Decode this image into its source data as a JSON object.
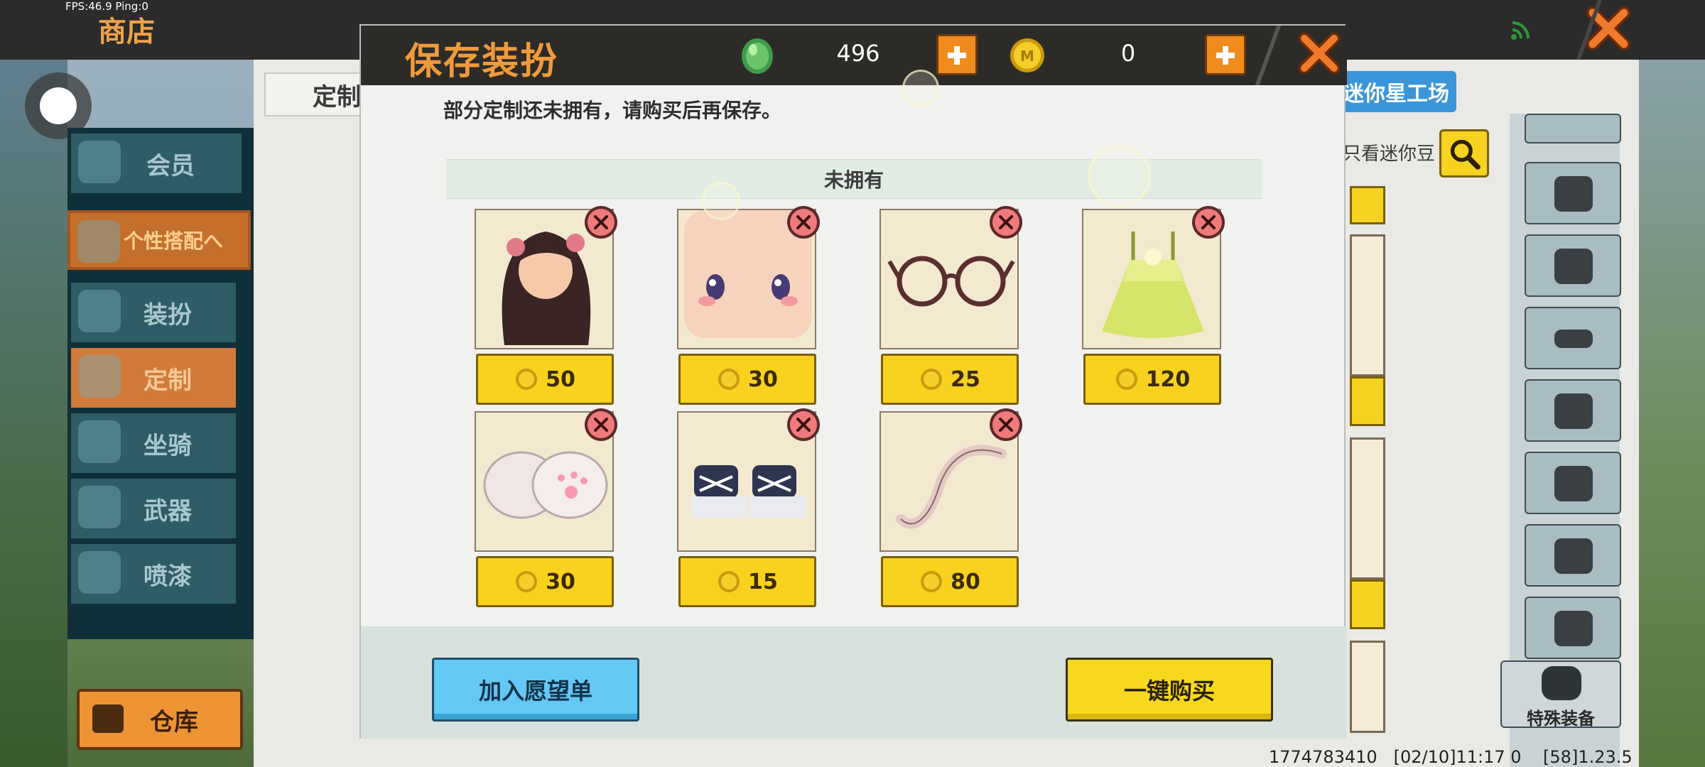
{
  "debug": {
    "fps_text": "FPS:46.9  Ping:0"
  },
  "topbar": {
    "title": "商店"
  },
  "sidebar": {
    "items": [
      {
        "label": "会员"
      },
      {
        "label": "个性搭配へ"
      },
      {
        "label": "装扮"
      },
      {
        "label": "定制"
      },
      {
        "label": "坐骑"
      },
      {
        "label": "武器"
      },
      {
        "label": "喷漆"
      }
    ],
    "warehouse_label": "仓库"
  },
  "store": {
    "tab_label": "定制",
    "factory_label": "迷你星工场",
    "filter_label": "只看迷你豆",
    "special_label": "特殊装备",
    "build_info": "1774783410   [02/10]11:17 0    [58]1.23.5"
  },
  "modal": {
    "title": "保存装扮",
    "gem_count": "496",
    "coin_count": "0",
    "notice": "部分定制还未拥有，请购买后再保存。",
    "section_title": "未拥有",
    "items": [
      {
        "name": "hair",
        "price": "50"
      },
      {
        "name": "face",
        "price": "30"
      },
      {
        "name": "glasses",
        "price": "25"
      },
      {
        "name": "dress",
        "price": "120"
      },
      {
        "name": "paws",
        "price": "30"
      },
      {
        "name": "sneakers",
        "price": "15"
      },
      {
        "name": "tail",
        "price": "80"
      }
    ],
    "wishlist_label": "加入愿望单",
    "buy_all_label": "一键购买"
  },
  "colors": {
    "accent_orange": "#f19a3b",
    "price_yellow": "#f8d21e",
    "wish_blue": "#64c8f4",
    "remove_red": "#f07a7a"
  },
  "icons": [
    "gem-icon",
    "coin-icon",
    "plus-icon",
    "close-icon",
    "remove-icon",
    "search-icon",
    "signal-icon",
    "chest-icon"
  ]
}
